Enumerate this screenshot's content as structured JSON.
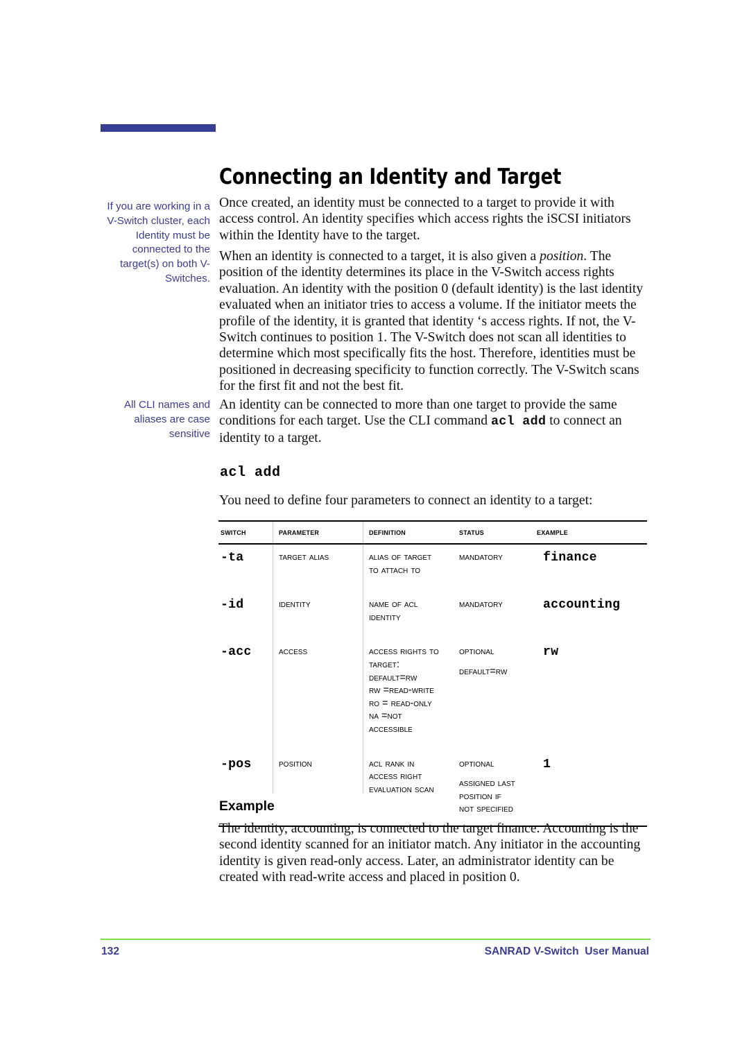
{
  "theme": {
    "accent_bar_color": "#363f93",
    "margin_note_color": "#3d3d8f",
    "footer_rule_color": "#7ddc48",
    "footer_text_color": "#3d3d8f",
    "body_text_color": "#101010"
  },
  "header": {
    "title": "Connecting an Identity and Target"
  },
  "margin_notes": [
    {
      "id": "cluster-note",
      "text": "If you are working in a V-Switch cluster, each Identity must be connected to the target(s) on both V-Switches."
    },
    {
      "id": "case-note",
      "text": "All CLI names and aliases are case sensitive"
    }
  ],
  "body": {
    "paragraph_1": "Once created, an identity must be connected to a target to provide it with access control.  An identity specifies which access rights the iSCSI initiators within the Identity have to the target.",
    "paragraph_2_a": "When an identity is connected to a target, it is also given a ",
    "paragraph_2_italic": "position",
    "paragraph_2_b": ".  The position of the identity determines its place in the V-Switch access rights evaluation.  An identity with the position 0 (default identity) is the last identity evaluated when an initiator tries to access a volume.  If the initiator meets the profile of the identity, it is granted that identity ‘s access rights.  If not, the V-Switch continues to position 1.  The V-Switch does not scan all identities to determine which most specifically fits the host.  Therefore, identities must be positioned in decreasing specificity to function correctly.  The V-Switch scans for the first fit and not the best fit.",
    "paragraph_3_a": "An identity can be connected to more than one target to provide the same conditions for each target.  Use the CLI command ",
    "paragraph_3_command": "acl add",
    "paragraph_3_b": " to connect an identity to a target.",
    "cli_heading": "acl add",
    "table_intro": "You need to define four parameters to connect an identity to a target:"
  },
  "table": {
    "columns": [
      "Switch",
      "Parameter",
      "Definition",
      "Status",
      "Example"
    ],
    "rows": [
      {
        "switch": "-ta",
        "parameter": "Target Alias",
        "definition_lines": [
          "Alias of target",
          "to attach to"
        ],
        "status_lines": [
          "Mandatory"
        ],
        "example": "finance"
      },
      {
        "switch": "-id",
        "parameter": "Identity",
        "definition_lines": [
          "Name of ACL",
          "identity"
        ],
        "status_lines": [
          "Mandatory"
        ],
        "example": "accounting"
      },
      {
        "switch": "-acc",
        "parameter": "Access",
        "definition_lines": [
          "Access rights to",
          "target:",
          "default=rw",
          "rw =read-write",
          "ro = read-only",
          "na =not",
          "accessible"
        ],
        "status_lines": [
          "Optional",
          "",
          "default=rw"
        ],
        "example": "rw"
      },
      {
        "switch": "-pos",
        "parameter": "Position",
        "definition_lines": [
          "ACL rank in",
          "access right",
          "evaluation scan"
        ],
        "status_lines": [
          "Optional",
          "",
          "assigned last",
          "position if",
          "not specified"
        ],
        "example": "1"
      }
    ]
  },
  "example_section": {
    "heading": "Example",
    "text": "The identity, accounting, is connected to the target finance.  Accounting is the second identity scanned for an initiator match.  Any initiator in the accounting identity is given read-only access.  Later, an administrator identity can be created with read-write access and placed in position 0."
  },
  "footer": {
    "page_number": "132",
    "manual_title": "SANRAD V-Switch  User Manual"
  }
}
